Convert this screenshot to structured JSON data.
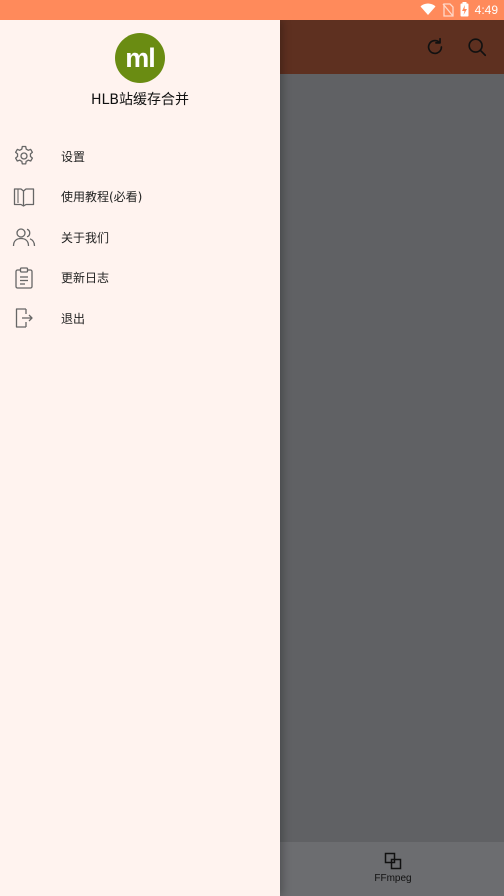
{
  "status_bar": {
    "time": "4:49",
    "icons": [
      "wifi-icon",
      "no-sim-icon",
      "battery-charging-icon"
    ]
  },
  "toolbar": {
    "actions": [
      "refresh-icon",
      "search-icon"
    ]
  },
  "drawer": {
    "avatar_text": "ml",
    "avatar_color": "#6a8c12",
    "app_name": "HLB站缓存合并",
    "items": [
      {
        "label": "设置",
        "icon": "gear-icon"
      },
      {
        "label": "使用教程(必看)",
        "icon": "book-icon"
      },
      {
        "label": "关于我们",
        "icon": "users-icon"
      },
      {
        "label": "更新日志",
        "icon": "clipboard-icon"
      },
      {
        "label": "退出",
        "icon": "logout-icon"
      }
    ]
  },
  "bottom_nav": {
    "tab_label": "FFmpeg",
    "tab_icon": "ffmpeg-icon"
  },
  "colors": {
    "status_bar": "#ff8a5b",
    "toolbar": "#5e3020",
    "drawer_bg": "#fff3ef",
    "scrim": "#606164"
  }
}
